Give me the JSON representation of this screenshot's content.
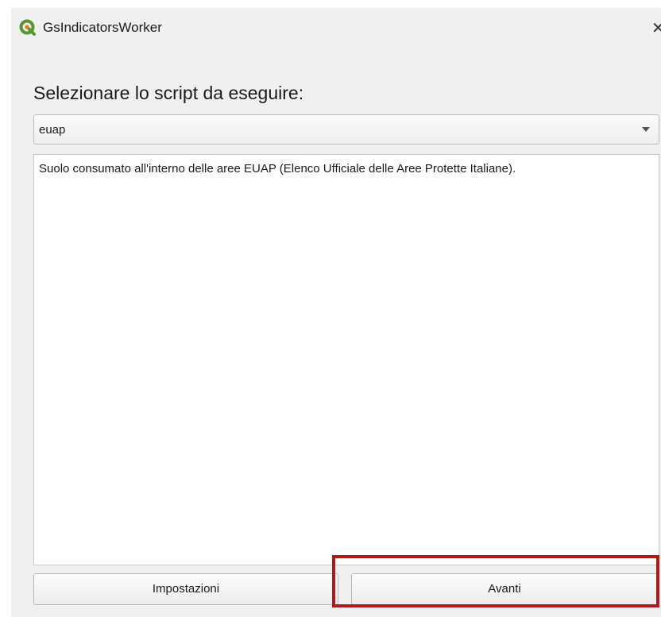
{
  "window": {
    "title": "GsIndicatorsWorker",
    "icon": "qgis-logo-icon",
    "close_glyph": "✕"
  },
  "main": {
    "heading": "Selezionare lo script da eseguire:",
    "script_select": {
      "selected": "euap",
      "icon": "chevron-down-icon"
    },
    "description": "Suolo consumato all'interno delle aree EUAP (Elenco Ufficiale delle Aree Protette Italiane)."
  },
  "buttons": {
    "settings_label": "Impostazioni",
    "next_label": "Avanti"
  },
  "colors": {
    "highlight": "#b01919",
    "qgis_green": "#589632",
    "qgis_yellow": "#ee7913"
  }
}
